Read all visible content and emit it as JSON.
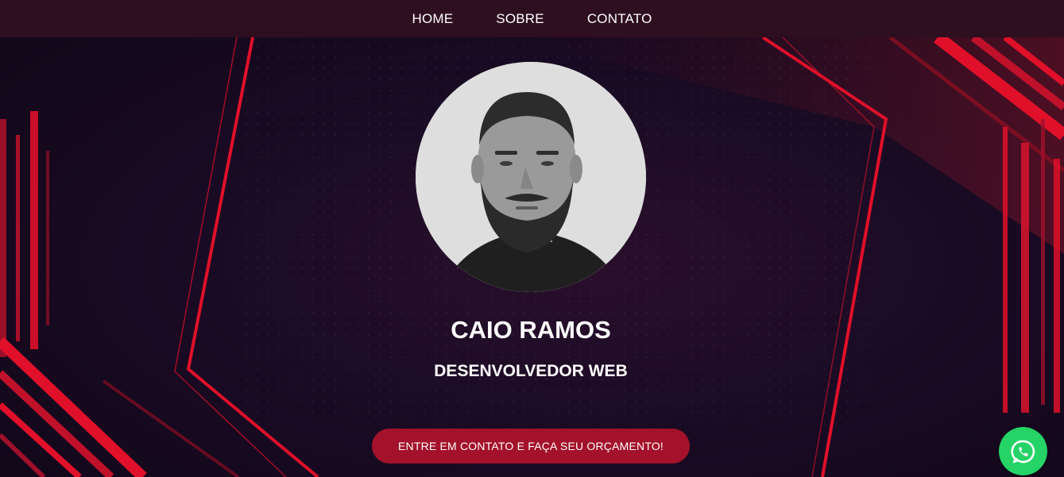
{
  "nav": {
    "items": [
      {
        "label": "HOME"
      },
      {
        "label": "SOBRE"
      },
      {
        "label": "CONTATO"
      }
    ]
  },
  "hero": {
    "name": "CAIO RAMOS",
    "role": "DESENVOLVEDOR WEB",
    "cta_label": "ENTRE EM CONTATO E FAÇA SEU ORÇAMENTO!"
  },
  "floating": {
    "whatsapp_icon": "whatsapp-icon"
  },
  "colors": {
    "navbar": "#2e0f1f",
    "background": "#1a0b24",
    "accent_red": "#e0102a",
    "button": "#a3122a",
    "whatsapp": "#25d366"
  }
}
